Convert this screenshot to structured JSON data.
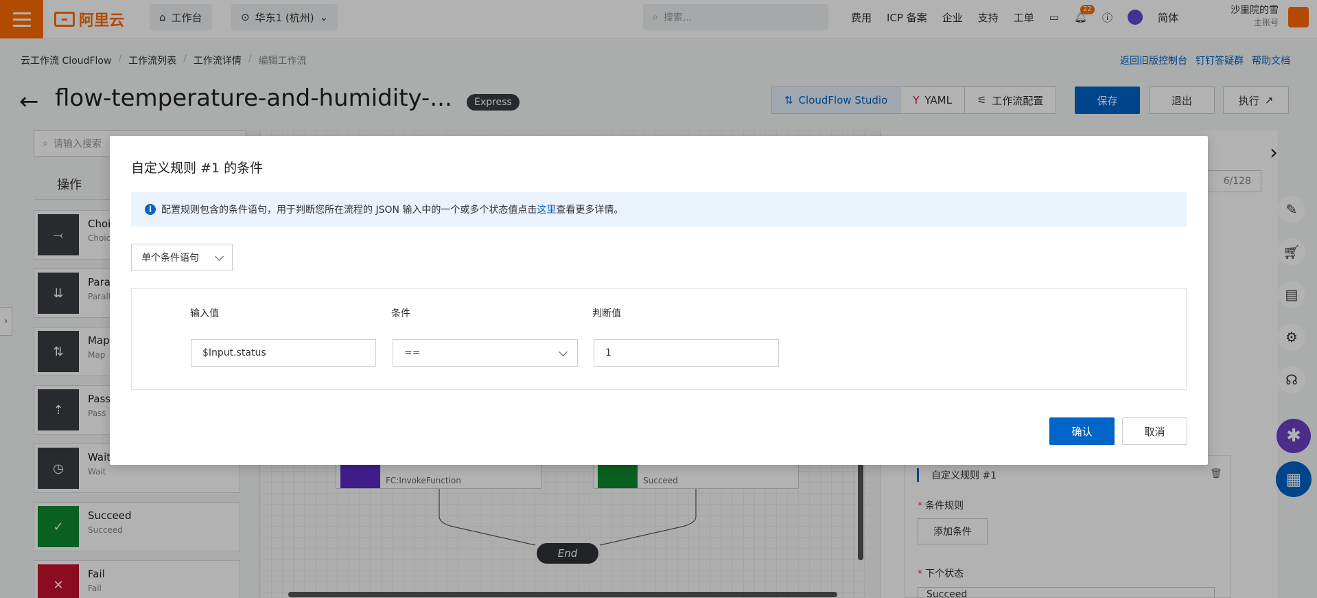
{
  "topbar": {
    "logo_text": "阿里云",
    "workbench": "工作台",
    "region": "华东1 (杭州)",
    "search_placeholder": "搜索...",
    "links": [
      "费用",
      "ICP 备案",
      "企业",
      "支持",
      "工单"
    ],
    "notification_count": "22",
    "language": "简体",
    "user_name": "沙里院的雪",
    "user_role": "主账号"
  },
  "breadcrumb": [
    "云工作流 CloudFlow",
    "工作流列表",
    "工作流详情",
    "编辑工作流"
  ],
  "header_links": [
    "返回旧版控制台",
    "钉钉答疑群",
    "帮助文档"
  ],
  "page": {
    "title": "flow-temperature-and-humidity-...",
    "tag": "Express"
  },
  "toolbar": {
    "studio": "CloudFlow Studio",
    "yaml": "YAML",
    "config": "工作流配置",
    "save": "保存",
    "exit": "退出",
    "run": "执行"
  },
  "left_panel": {
    "search_placeholder": "请输入搜索",
    "tab": "操作",
    "states": [
      {
        "name": "Choic",
        "sub": "Choic",
        "color": "#3a3d42",
        "icon": "⤙"
      },
      {
        "name": "Parall",
        "sub": "Paralle",
        "color": "#3a3d42",
        "icon": "⇊"
      },
      {
        "name": "Map",
        "sub": "Map",
        "color": "#3a3d42",
        "icon": "⇅"
      },
      {
        "name": "Pass",
        "sub": "Pass",
        "color": "#3a3d42",
        "icon": "⇡"
      },
      {
        "name": "Wait",
        "sub": "Wait",
        "color": "#3a3d42",
        "icon": "◷"
      },
      {
        "name": "Succeed",
        "sub": "Succeed",
        "color": "#0f8a2f",
        "icon": "✓"
      },
      {
        "name": "Fail",
        "sub": "Fail",
        "color": "#c8102e",
        "icon": "✕"
      }
    ]
  },
  "canvas": {
    "node_invoke": "FC:InvokeFunction",
    "node_succeed": "Succeed",
    "end": "End"
  },
  "right_panel": {
    "counter": "6/128",
    "rule_title": "自定义规则 #1",
    "condition_label": "条件规则",
    "add_condition": "添加条件",
    "next_state_label": "下个状态",
    "next_state_value": "Succeed"
  },
  "modal": {
    "title": "自定义规则 #1 的条件",
    "info_text": "配置规则包含的条件语句，用于判断您所在流程的 JSON 输入中的一个或多个状态值点击",
    "info_link": "这里",
    "info_suffix": "查看更多详情。",
    "condition_type": "单个条件语句",
    "col_input": "输入值",
    "col_condition": "条件",
    "col_value": "判断值",
    "input_value": "$Input.status",
    "operator": "==",
    "compare_value": "1",
    "confirm": "确认",
    "cancel": "取消"
  }
}
